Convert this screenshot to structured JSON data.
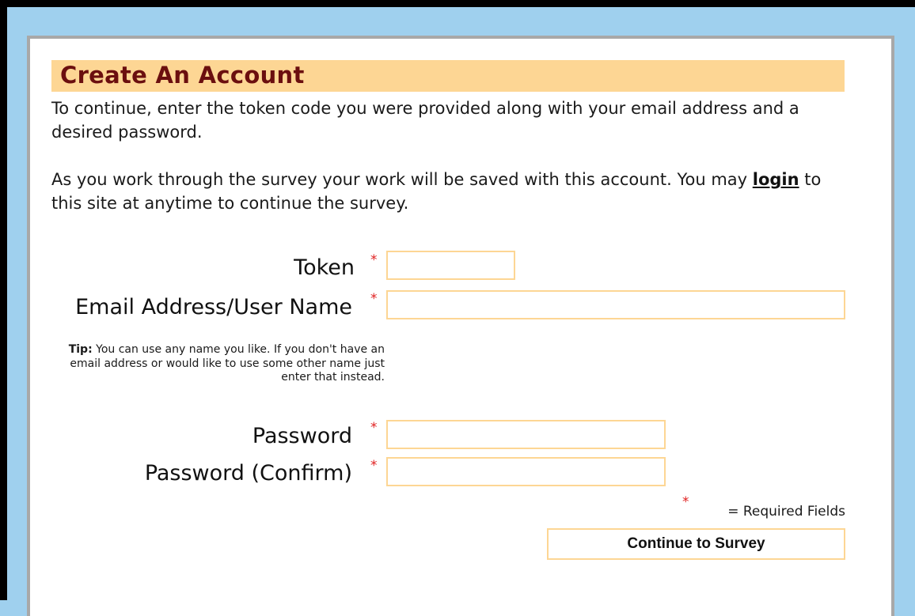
{
  "header": {
    "title": "Create An Account"
  },
  "intro": {
    "paragraph1": "To continue, enter the token code you were provided along with your email address and a desired password.",
    "paragraph2_before": "As you work through the survey your work will be saved with this account. You may ",
    "login_link": "login",
    "paragraph2_after": " to this site at anytime to continue the survey."
  },
  "form": {
    "required_mark": "*",
    "token": {
      "label": "Token",
      "value": ""
    },
    "email": {
      "label": "Email Address/User Name",
      "value": ""
    },
    "tip": {
      "prefix": "Tip:",
      "text": " You can use any name you like. If you don't have an email address or would like to use some other name just enter that instead."
    },
    "password": {
      "label": "Password",
      "value": ""
    },
    "password_confirm": {
      "label": "Password (Confirm)",
      "value": ""
    },
    "required_legend": "= Required Fields",
    "submit_label": "Continue to Survey"
  },
  "colors": {
    "header_bg": "#fdd694",
    "header_text": "#6b0f0f",
    "page_bg": "#9fd0ee",
    "required": "#e02020"
  }
}
